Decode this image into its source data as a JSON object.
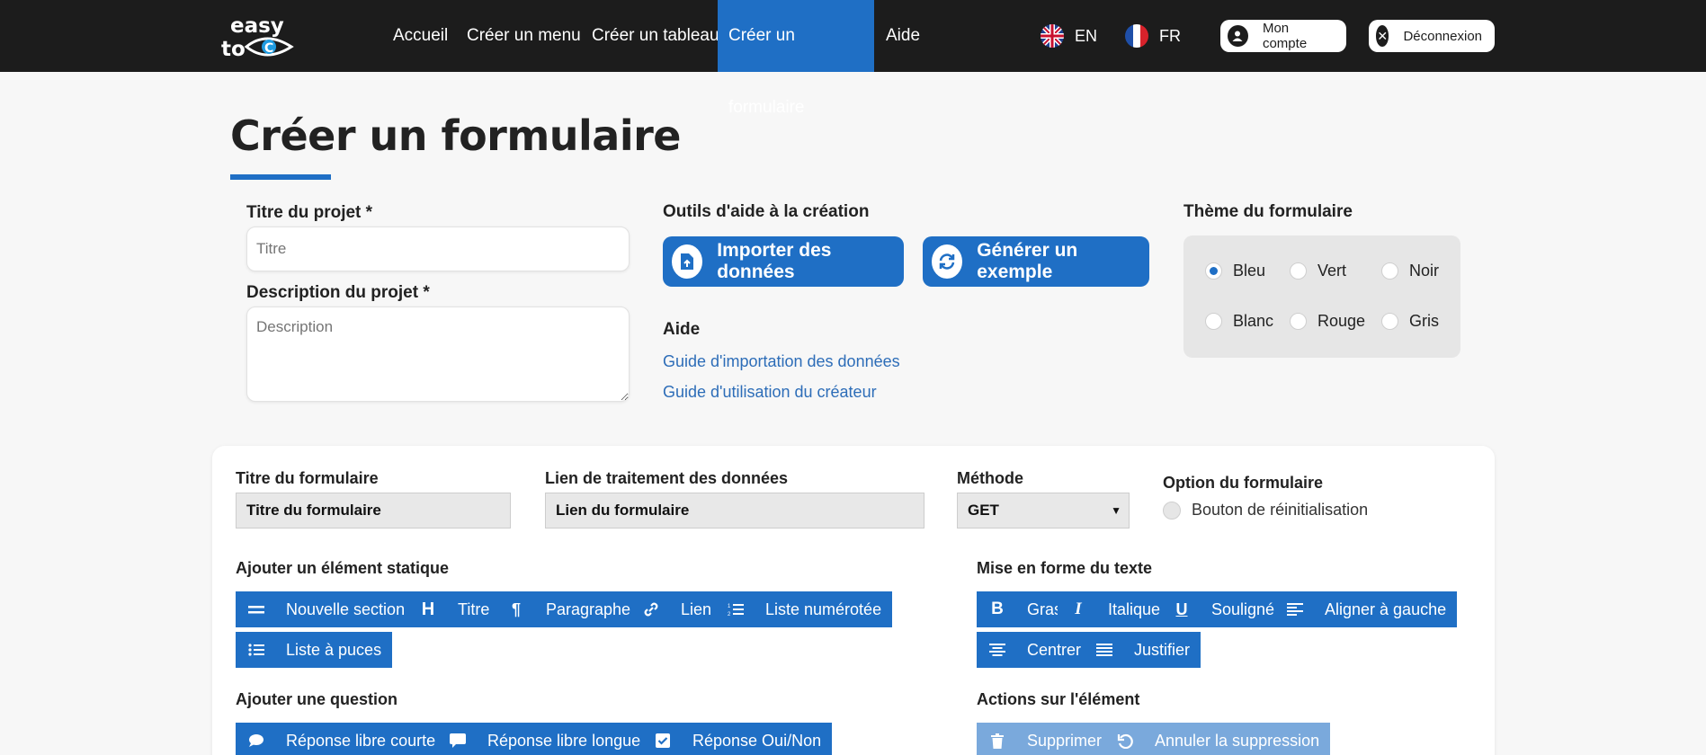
{
  "nav": {
    "logo_text": "easy to",
    "links": [
      "Accueil",
      "Créer un menu",
      "Créer un tableau",
      "Créer un formulaire",
      "Aide"
    ],
    "active": "Créer un formulaire",
    "lang_en": "EN",
    "lang_fr": "FR",
    "account": "Mon compte",
    "logout": "Déconnexion"
  },
  "page": {
    "title": "Créer un formulaire",
    "project_title_label": "Titre du projet *",
    "project_title_placeholder": "Titre",
    "project_desc_label": "Description du projet *",
    "project_desc_placeholder": "Description",
    "tools_label": "Outils d'aide à la création",
    "import_btn": "Importer des données",
    "generate_btn": "Générer un exemple",
    "help_label": "Aide",
    "help_link1": "Guide d'importation des données",
    "help_link2": "Guide d'utilisation du créateur",
    "theme_label": "Thème du formulaire",
    "themes": [
      "Bleu",
      "Vert",
      "Noir",
      "Blanc",
      "Rouge",
      "Gris"
    ],
    "theme_selected": "Bleu"
  },
  "form": {
    "title_label": "Titre du formulaire",
    "title_value": "Titre du formulaire",
    "link_label": "Lien de traitement des données",
    "link_value": "Lien du formulaire",
    "method_label": "Méthode",
    "method_value": "GET",
    "option_label": "Option du formulaire",
    "option_reset": "Bouton de réinitialisation",
    "static_label": "Ajouter un élément statique",
    "static_buttons": [
      "Nouvelle section",
      "Titre",
      "Paragraphe",
      "Lien",
      "Liste numérotée",
      "Liste à puces"
    ],
    "format_label": "Mise en forme du texte",
    "format_buttons": [
      "Gras",
      "Italique",
      "Souligné",
      "Aligner à gauche",
      "Centrer",
      "Justifier"
    ],
    "question_label": "Ajouter une question",
    "question_buttons": [
      "Réponse libre courte",
      "Réponse libre longue",
      "Réponse Oui/Non"
    ],
    "actions_label": "Actions sur l'élément",
    "action_buttons": [
      "Supprimer",
      "Annuler la suppression"
    ]
  },
  "colors": {
    "nav_bg": "#1c1c1c",
    "accent": "#1f6fc5",
    "disabled": "#7aa9dc"
  }
}
